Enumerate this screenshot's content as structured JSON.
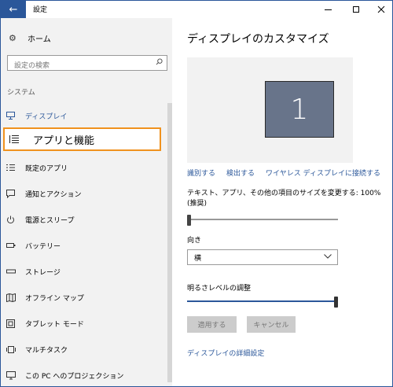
{
  "window": {
    "title": "設定"
  },
  "sidebar": {
    "home_label": "ホーム",
    "search_placeholder": "設定の検索",
    "section_label": "システム",
    "items": [
      {
        "label": "ディスプレイ",
        "icon": "monitor-icon"
      },
      {
        "label": "アプリと機能",
        "icon": "list-icon"
      },
      {
        "label": "既定のアプリ",
        "icon": "default-apps-icon"
      },
      {
        "label": "通知とアクション",
        "icon": "notification-icon"
      },
      {
        "label": "電源とスリープ",
        "icon": "power-icon"
      },
      {
        "label": "バッテリー",
        "icon": "battery-icon"
      },
      {
        "label": "ストレージ",
        "icon": "storage-icon"
      },
      {
        "label": "オフライン マップ",
        "icon": "map-icon"
      },
      {
        "label": "タブレット モード",
        "icon": "tablet-icon"
      },
      {
        "label": "マルチタスク",
        "icon": "multitask-icon"
      },
      {
        "label": "この PC へのプロジェクション",
        "icon": "projection-icon"
      }
    ]
  },
  "main": {
    "title": "ディスプレイのカスタマイズ",
    "monitor_number": "1",
    "links": [
      "識別する",
      "検出する",
      "ワイヤレス ディスプレイに接続する"
    ],
    "scale_label": "テキスト、アプリ、その他の項目のサイズを変更する: 100% (推奨)",
    "scale_value": 0.0,
    "orientation_label": "向き",
    "orientation_value": "横",
    "brightness_label": "明るさレベルの調整",
    "brightness_value": 1.0,
    "apply_button": "適用する",
    "cancel_button": "キャンセル",
    "advanced_link": "ディスプレイの詳細設定"
  },
  "colors": {
    "accent": "#2b579a",
    "highlight": "#f0921e"
  }
}
